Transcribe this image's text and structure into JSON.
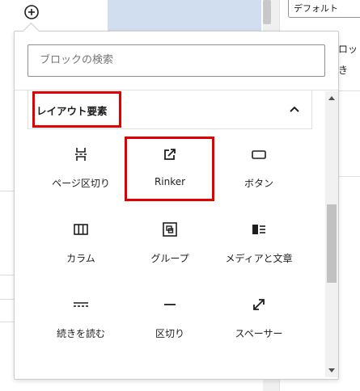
{
  "background": {
    "select_value": "デフォルト",
    "right_text_1": "ドロッ",
    "right_text_2": "大き",
    "right_text_3": "="
  },
  "inserter": {
    "search_placeholder": "ブロックの検索",
    "category_title": "レイアウト要素",
    "blocks": [
      {
        "label": "ページ区切り",
        "icon": "page-break-icon"
      },
      {
        "label": "Rinker",
        "icon": "external-link-icon"
      },
      {
        "label": "ボタン",
        "icon": "button-icon"
      },
      {
        "label": "カラム",
        "icon": "columns-icon"
      },
      {
        "label": "グループ",
        "icon": "group-icon"
      },
      {
        "label": "メディアと文章",
        "icon": "media-text-icon"
      },
      {
        "label": "続きを読む",
        "icon": "more-icon"
      },
      {
        "label": "区切り",
        "icon": "separator-icon"
      },
      {
        "label": "スペーサー",
        "icon": "spacer-icon"
      }
    ]
  },
  "colors": {
    "highlight": "#e00000",
    "text": "#1e1e1e"
  }
}
